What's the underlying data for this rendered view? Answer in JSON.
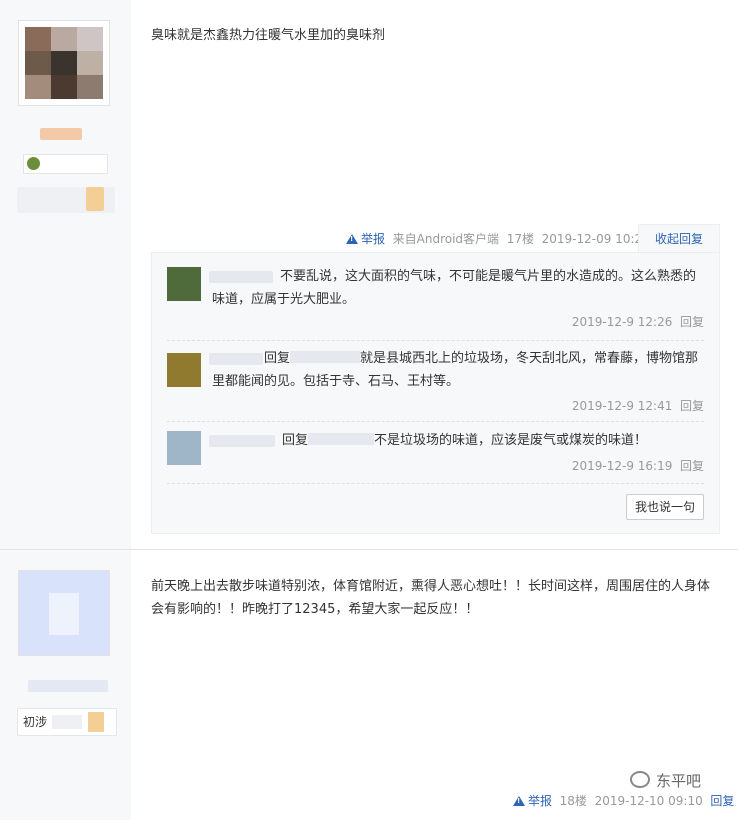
{
  "post1": {
    "content": "臭味就是杰鑫热力往暖气水里加的臭味剂",
    "report": "举报",
    "client": "来自Android客户端",
    "floor": "17楼",
    "time": "2019-12-09 10:25",
    "collapse_label": "收起回复",
    "replies": [
      {
        "text": "不要乱说，这大面积的气味，不可能是暖气片里的水造成的。这么熟悉的味道，应属于光大肥业。",
        "time": "2019-12-9 12:26",
        "reply_label": "回复"
      },
      {
        "prefix": "回复",
        "text": "就是县城西北上的垃圾场，冬天刮北风，常春藤，博物馆那里都能闻的见。包括于寺、石马、王村等。",
        "time": "2019-12-9 12:41",
        "reply_label": "回复"
      },
      {
        "prefix": "回复",
        "text": "不是垃圾场的味道，应该是废气或煤炭的味道！",
        "time": "2019-12-9 16:19",
        "reply_label": "回复"
      }
    ],
    "say_button": "我也说一句"
  },
  "post2": {
    "content": "前天晚上出去散步味道特别浓，体育馆附近，熏得人恶心想吐！！长时间这样，周围居住的人身体会有影响的！！昨晚打了12345，希望大家一起反应！！",
    "level_text": "初涉",
    "report": "举报",
    "floor": "18楼",
    "time": "2019-12-10 09:10",
    "reply_label": "回复"
  },
  "watermark": "东平吧",
  "colors": {
    "link": "#2d64b3",
    "meta": "#999999",
    "sidebar": "#f7f8fa"
  }
}
